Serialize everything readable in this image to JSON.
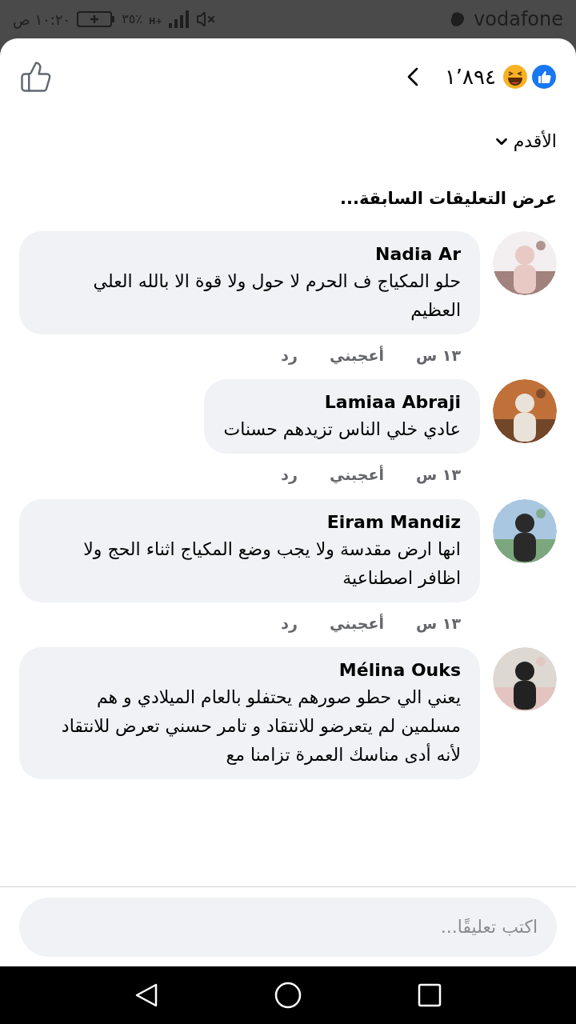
{
  "status_bar": {
    "carrier": "vodafone",
    "network": "H+",
    "battery": "٣٥٪",
    "time": "١٠:٢٠ ص"
  },
  "header": {
    "reaction_count": "١٬٨٩٤"
  },
  "sort": {
    "label": "الأقدم"
  },
  "previous_comments": "عرض التعليقات السابقة...",
  "comments": [
    {
      "name": "Nadia Ar",
      "text": "حلو المكياج ف الحرم لا حول ولا قوة الا بالله العلي العظيم",
      "time": "١٣ س",
      "like": "أعجبني",
      "reply": "رد"
    },
    {
      "name": "Lamiaa Abraji",
      "text": "عادي خلي الناس تزيدهم حسنات",
      "time": "١٣ س",
      "like": "أعجبني",
      "reply": "رد"
    },
    {
      "name": "Eiram Mandiz",
      "text": "انها ارض مقدسة ولا يجب وضع المكياج اثناء الحج ولا اظافر اصطناعية",
      "time": "١٣ س",
      "like": "أعجبني",
      "reply": "رد"
    },
    {
      "name": "Mélina Ouks",
      "text": "يعني الي حطو صورهم يحتفلو بالعام الميلادي و هم مسلمين لم يتعرضو للانتقاد و تامر حسني تعرض للانتقاد لأنه أدى مناسك العمرة تزامنا مع"
    }
  ],
  "composer": {
    "placeholder": "اكتب تعليقًا..."
  }
}
